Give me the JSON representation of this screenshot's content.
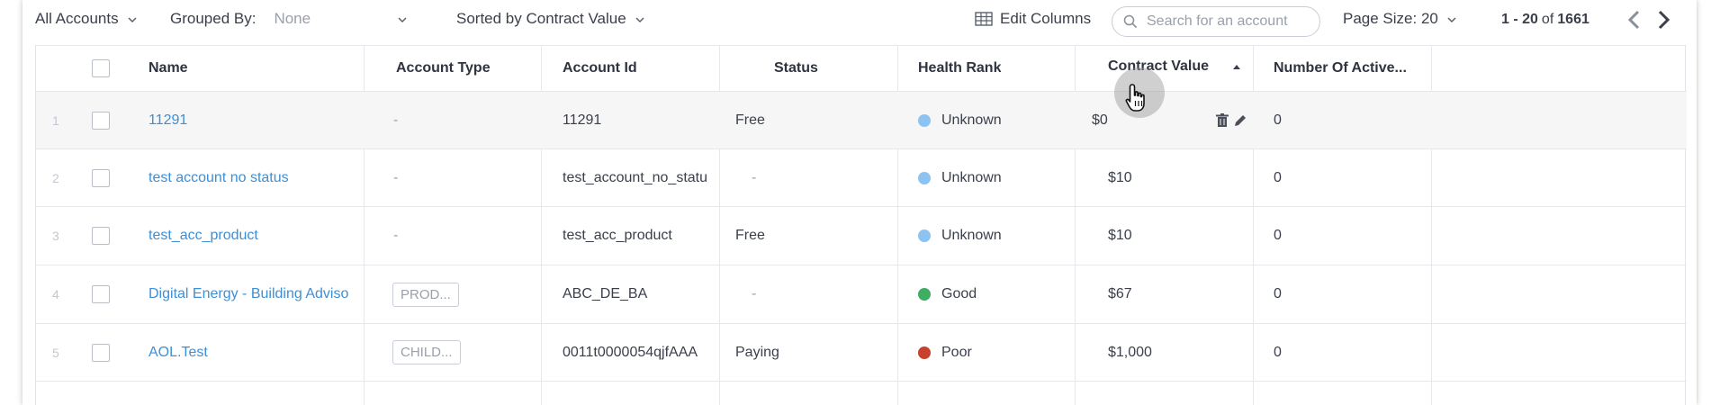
{
  "toolbar": {
    "view_label": "All Accounts",
    "grouped_by_label": "Grouped By:",
    "grouped_by_value": "None",
    "sorted_label": "Sorted by Contract Value",
    "edit_columns_label": "Edit Columns",
    "search_placeholder": "Search for an account",
    "page_size_label": "Page Size: 20",
    "range_text": "1 - 20",
    "of_text": "of",
    "total_text": "1661"
  },
  "columns": {
    "name": "Name",
    "account_type": "Account Type",
    "account_id": "Account Id",
    "status": "Status",
    "health_rank": "Health Rank",
    "contract_value": "Contract Value",
    "active": "Number Of Active..."
  },
  "rows": [
    {
      "num": "1",
      "name": "11291",
      "type": "-",
      "account_id": "11291",
      "status": "Free",
      "health": "Unknown",
      "health_color": "#8dc3f0",
      "contract": "$0",
      "active": "0"
    },
    {
      "num": "2",
      "name": "test account no status",
      "type": "-",
      "account_id": "test_account_no_statu",
      "status": "-",
      "health": "Unknown",
      "health_color": "#8dc3f0",
      "contract": "$10",
      "active": "0"
    },
    {
      "num": "3",
      "name": "test_acc_product",
      "type": "-",
      "account_id": "test_acc_product",
      "status": "Free",
      "health": "Unknown",
      "health_color": "#8dc3f0",
      "contract": "$10",
      "active": "0"
    },
    {
      "num": "4",
      "name": "Digital Energy - Building Adviso",
      "type": "PROD...",
      "account_id": "ABC_DE_BA",
      "status": "-",
      "health": "Good",
      "health_color": "#3fae63",
      "contract": "$67",
      "active": "0"
    },
    {
      "num": "5",
      "name": "AOL.Test",
      "type": "CHILD...",
      "account_id": "0011t0000054qjfAAA",
      "status": "Paying",
      "health": "Poor",
      "health_color": "#c8412d",
      "contract": "$1,000",
      "active": "0"
    }
  ]
}
